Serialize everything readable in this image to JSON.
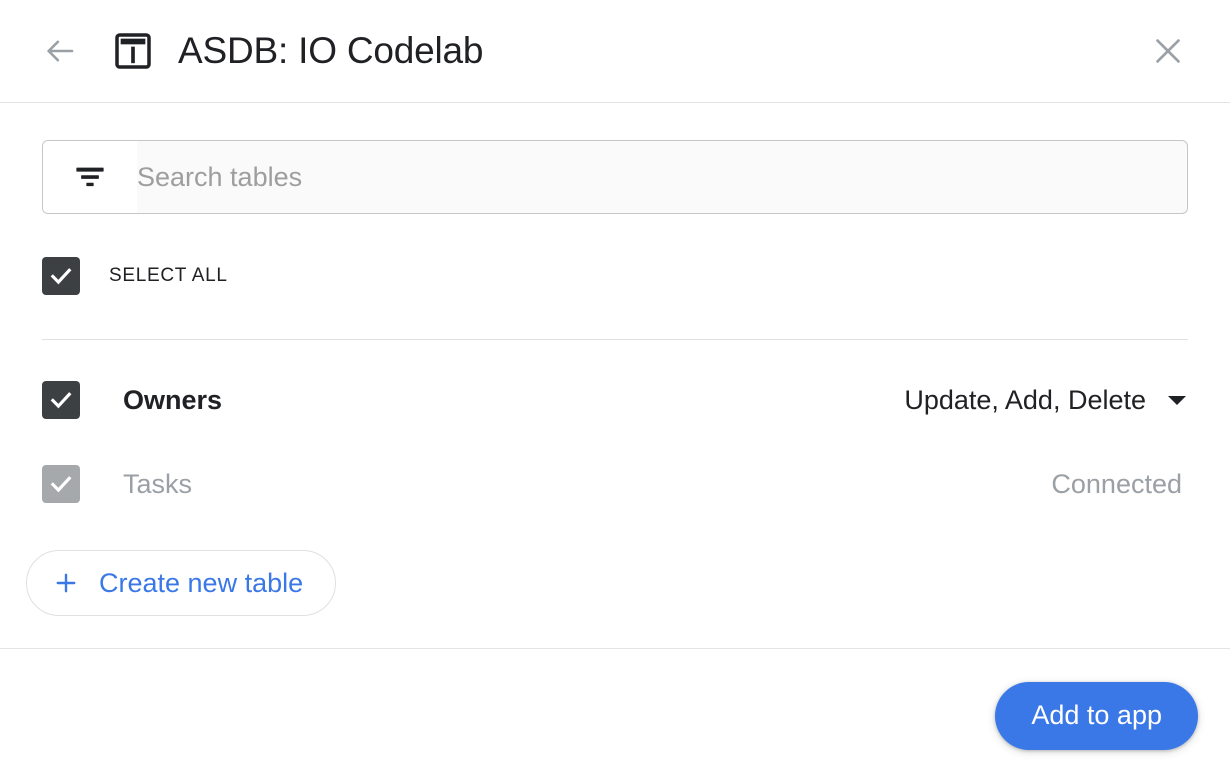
{
  "header": {
    "title": "ASDB: IO Codelab",
    "back_icon": "arrow-left-icon",
    "title_icon": "table-icon",
    "close_icon": "close-icon"
  },
  "search": {
    "placeholder": "Search tables",
    "value": "",
    "icon": "filter-icon"
  },
  "select_all": {
    "label": "SELECT ALL",
    "checked": true
  },
  "tables": [
    {
      "name": "Owners",
      "checked": true,
      "disabled": false,
      "permission": "Update, Add, Delete",
      "has_dropdown": true,
      "dropdown_icon": "chevron-down-icon"
    },
    {
      "name": "Tasks",
      "checked": true,
      "disabled": true,
      "status": "Connected",
      "has_dropdown": false
    }
  ],
  "create_table": {
    "label": "Create new table",
    "icon": "plus-icon"
  },
  "footer": {
    "primary_label": "Add to app"
  },
  "colors": {
    "accent": "#3b78e7",
    "checkbox": "#3c4043",
    "checkbox_disabled": "#a6a9ac",
    "muted_text": "#9aa0a6",
    "title_text": "#202124",
    "divider": "#e0e0e0"
  }
}
